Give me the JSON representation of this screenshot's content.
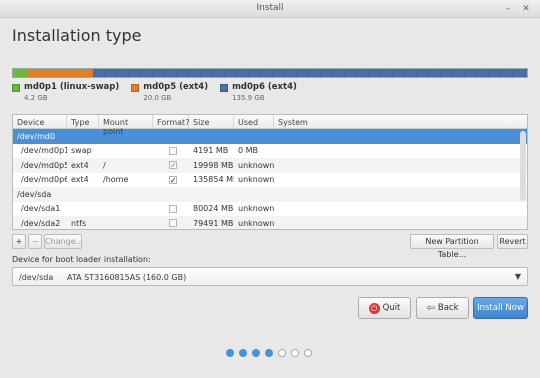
{
  "window": {
    "title": "Install"
  },
  "page": {
    "title": "Installation type"
  },
  "legend": [
    {
      "name": "md0p1 (linux-swap)",
      "size": "4.2 GB",
      "color": "#6ab83c"
    },
    {
      "name": "md0p5 (ext4)",
      "size": "20.0 GB",
      "color": "#e07f2a"
    },
    {
      "name": "md0p6 (ext4)",
      "size": "135.9 GB",
      "color": "#4a6fa5"
    }
  ],
  "table": {
    "headers": [
      "Device",
      "Type",
      "Mount point",
      "Format?",
      "Size",
      "Used",
      "System"
    ],
    "rows": [
      {
        "device": "/dev/md0",
        "group": true,
        "selected": true
      },
      {
        "device": "/dev/md0p1",
        "type": "swap",
        "mount": "",
        "format": "",
        "size": "4191 MB",
        "used": "0 MB"
      },
      {
        "device": "/dev/md0p5",
        "type": "ext4",
        "mount": "/",
        "format": "✓",
        "size": "19998 MB",
        "used": "unknown"
      },
      {
        "device": "/dev/md0p6",
        "type": "ext4",
        "mount": "/home",
        "format": "✓",
        "size": "135854 MB",
        "used": "unknown"
      },
      {
        "device": "/dev/sda",
        "group": true
      },
      {
        "device": "/dev/sda1",
        "type": "",
        "mount": "",
        "format": "",
        "size": "80024 MB",
        "used": "unknown"
      },
      {
        "device": "/dev/sda2",
        "type": "ntfs",
        "mount": "",
        "format": "",
        "size": "79491 MB",
        "used": "unknown"
      }
    ]
  },
  "toolbar": {
    "add": "+",
    "remove": "−",
    "change": "Change...",
    "new_table": "New Partition Table...",
    "revert": "Revert"
  },
  "boot": {
    "label": "Device for boot loader installation:",
    "device": "/dev/sda",
    "description": "ATA ST3160815AS (160.0 GB)"
  },
  "buttons": {
    "quit": "Quit",
    "back": "Back",
    "install": "Install Now"
  },
  "colors": {
    "accent": "#4a90d9",
    "quit": "#dd3333"
  },
  "progress": {
    "total_steps": 7,
    "current_step": 4
  }
}
